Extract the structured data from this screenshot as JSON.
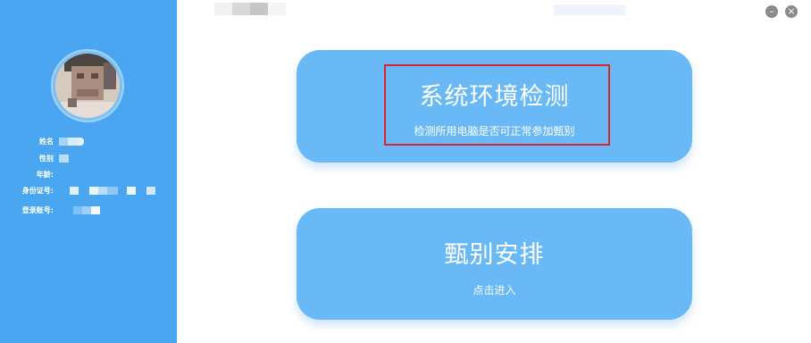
{
  "profile": {
    "fields": [
      {
        "label": "姓名"
      },
      {
        "label": "性别"
      },
      {
        "label": "年龄:"
      },
      {
        "label": "身份证号:"
      },
      {
        "label": "登录账号:"
      }
    ]
  },
  "cards": [
    {
      "title": "系统环境检测",
      "subtitle": "检测所用电脑是否可正常参加甄别"
    },
    {
      "title": "甄别安排",
      "subtitle": "点击进入"
    }
  ],
  "window_controls": {
    "minimize": "–",
    "close": "×"
  },
  "colors": {
    "sidebar": "#4aa6f0",
    "card": "#6ab9f7",
    "highlight": "#d9262a"
  }
}
